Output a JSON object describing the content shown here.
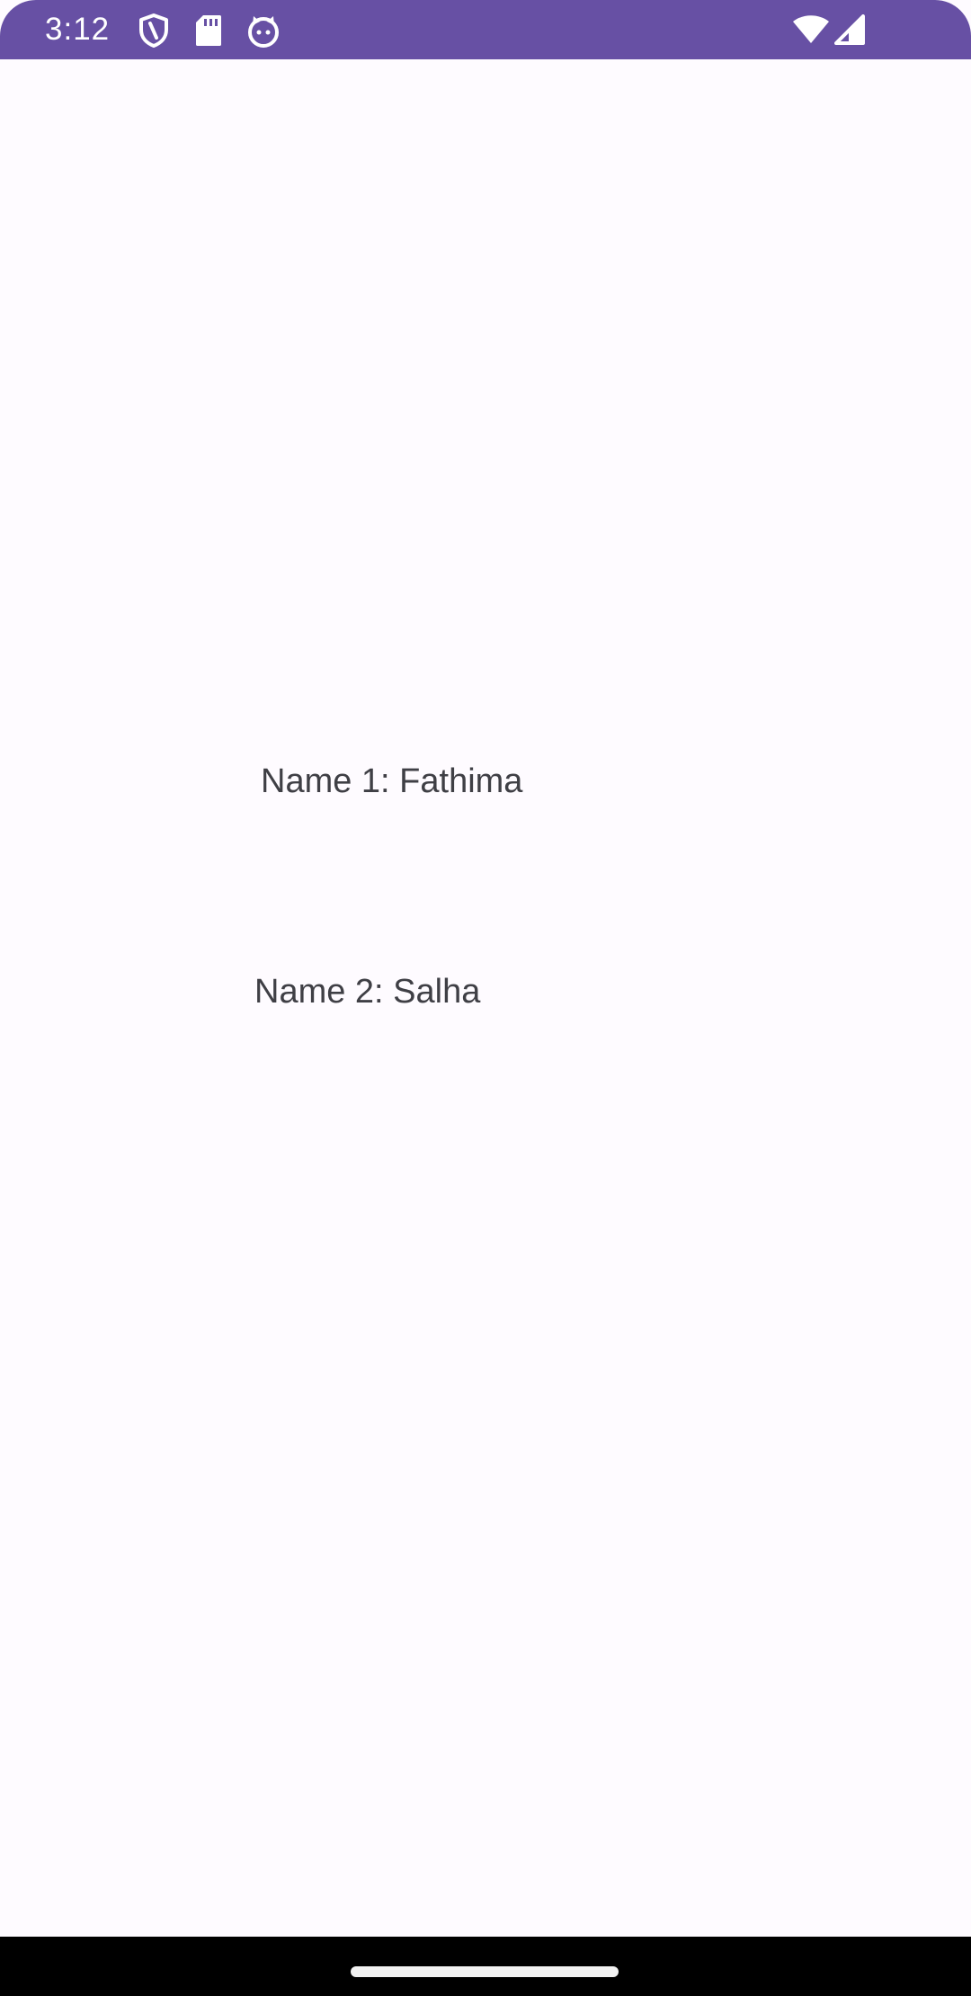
{
  "status_bar": {
    "time": "3:12",
    "background_color": "#6750A4",
    "left_icons": [
      "shield-icon",
      "sd-card-icon",
      "cat-face-icon"
    ],
    "right_icons": [
      "wifi-icon",
      "cell-signal-icon"
    ]
  },
  "main": {
    "name_1": "Name 1: Fathima",
    "name_2": "Name 2: Salha",
    "background_color": "#FEFBFF",
    "text_color": "#3F3F45"
  },
  "nav_bar": {
    "gesture_handle": "home-gesture-handle"
  }
}
